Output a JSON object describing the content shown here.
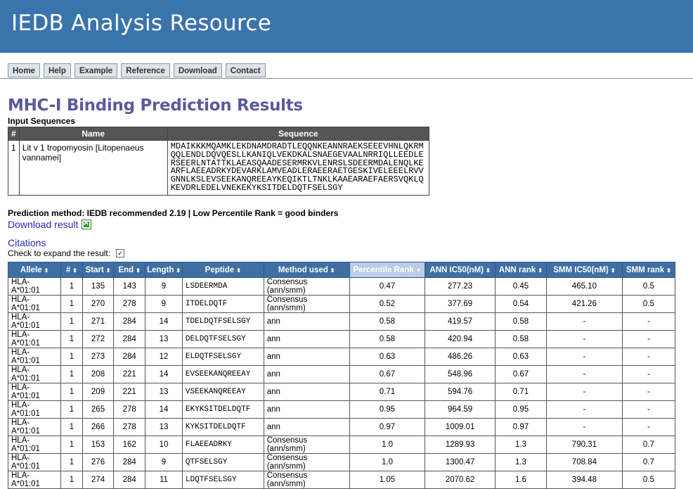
{
  "header": {
    "title": "IEDB Analysis Resource"
  },
  "nav": {
    "tabs": [
      "Home",
      "Help",
      "Example",
      "Reference",
      "Download",
      "Contact"
    ]
  },
  "page_title": "MHC-I Binding Prediction Results",
  "input": {
    "label": "Input Sequences",
    "columns": [
      "#",
      "Name",
      "Sequence"
    ],
    "row": {
      "num": "1",
      "name": "Lit v 1 tropomyosin [Litopenaeus vannamei]",
      "sequence": "MDAIKKKMQAMKLEKDNAMDRADTLEQQNKEANNRAEKSEEEVHNLQKRM\nQQLENDLDQVQESLLKANIQLVEKDKALSNAEGEVAALNRRIQLLEEDLE\nRSEERLNTATTKLAEASQAADESERMRKVLENRSLSDEERMDALENQLKE\nARFLAEEADRKYDEVARKLAMVEADLERAEERAETGESKIVELEEELRVV\nGNNLKSLEVSEEKANQREEAYKEQIKTLTNKLKAAEARAEFAERSVQKLQ\nKEVDRLEDELVNEKEKYKSITDELDQTFSELSGY"
    }
  },
  "method_text": "Prediction method: IEDB recommended 2.19 | Low Percentile Rank = good binders",
  "download_label": "Download result",
  "citations_label": "Citations",
  "expand_label": "Check to expand the result:",
  "expand_checked": true,
  "results": {
    "columns": [
      "Allele",
      "#",
      "Start",
      "End",
      "Length",
      "Peptide",
      "Method used",
      "Percentile Rank",
      "ANN IC50(nM)",
      "ANN rank",
      "SMM IC50(nM)",
      "SMM rank"
    ],
    "sorted_column": "Percentile Rank",
    "rows": [
      [
        "HLA-A*01:01",
        "1",
        "135",
        "143",
        "9",
        "LSDEERMDA",
        "Consensus (ann/smm)",
        "0.47",
        "277.23",
        "0.45",
        "465.10",
        "0.5"
      ],
      [
        "HLA-A*01:01",
        "1",
        "270",
        "278",
        "9",
        "ITDELDQTF",
        "Consensus (ann/smm)",
        "0.52",
        "377.69",
        "0.54",
        "421.26",
        "0.5"
      ],
      [
        "HLA-A*01:01",
        "1",
        "271",
        "284",
        "14",
        "TDELDQTFSELSGY",
        "ann",
        "0.58",
        "419.57",
        "0.58",
        "-",
        "-"
      ],
      [
        "HLA-A*01:01",
        "1",
        "272",
        "284",
        "13",
        "DELDQTFSELSGY",
        "ann",
        "0.58",
        "420.94",
        "0.58",
        "-",
        "-"
      ],
      [
        "HLA-A*01:01",
        "1",
        "273",
        "284",
        "12",
        "ELDQTFSELSGY",
        "ann",
        "0.63",
        "486.26",
        "0.63",
        "-",
        "-"
      ],
      [
        "HLA-A*01:01",
        "1",
        "208",
        "221",
        "14",
        "EVSEEKANQREEAY",
        "ann",
        "0.67",
        "548.96",
        "0.67",
        "-",
        "-"
      ],
      [
        "HLA-A*01:01",
        "1",
        "209",
        "221",
        "13",
        "VSEEKANQREEAY",
        "ann",
        "0.71",
        "594.76",
        "0.71",
        "-",
        "-"
      ],
      [
        "HLA-A*01:01",
        "1",
        "265",
        "278",
        "14",
        "EKYKSITDELDQTF",
        "ann",
        "0.95",
        "964.59",
        "0.95",
        "-",
        "-"
      ],
      [
        "HLA-A*01:01",
        "1",
        "266",
        "278",
        "13",
        "KYKSITDELDQTF",
        "ann",
        "0.97",
        "1009.01",
        "0.97",
        "-",
        "-"
      ],
      [
        "HLA-A*01:01",
        "1",
        "153",
        "162",
        "10",
        "FLAEEADRKY",
        "Consensus (ann/smm)",
        "1.0",
        "1289.93",
        "1.3",
        "790.31",
        "0.7"
      ],
      [
        "HLA-A*01:01",
        "1",
        "276",
        "284",
        "9",
        "QTFSELSGY",
        "Consensus (ann/smm)",
        "1.0",
        "1300.47",
        "1.3",
        "708.84",
        "0.7"
      ],
      [
        "HLA-A*01:01",
        "1",
        "274",
        "284",
        "11",
        "LDQTFSELSGY",
        "Consensus (ann/smm)",
        "1.05",
        "2070.62",
        "1.6",
        "394.48",
        "0.5"
      ]
    ]
  },
  "colors": {
    "banner": "#3a74ad",
    "header": "#3f6fa3",
    "active_header": "#b8cde6",
    "title": "#5a5a9e",
    "link": "#2a28c8"
  }
}
